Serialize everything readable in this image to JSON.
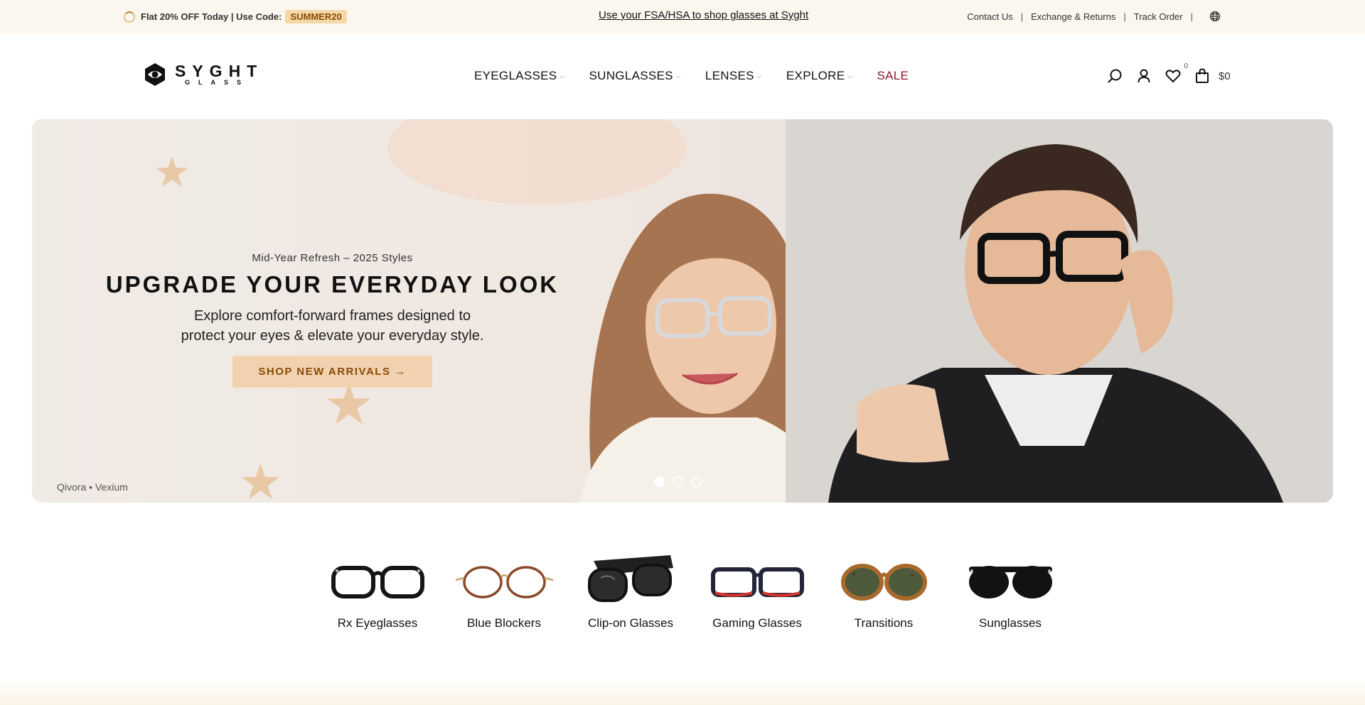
{
  "topbar": {
    "promo_text": "Flat 20% OFF Today | Use Code:",
    "promo_code": "SUMMER20",
    "fsa_link": "Use your FSA/HSA to shop glasses at Syght",
    "links": [
      "Contact Us",
      "Exchange & Returns",
      "Track Order"
    ],
    "separator": "|"
  },
  "brand": {
    "word": "SYGHT",
    "sub": "GLASS"
  },
  "nav": {
    "items": [
      {
        "label": "EYEGLASSES",
        "has_dropdown": true
      },
      {
        "label": "SUNGLASSES",
        "has_dropdown": true
      },
      {
        "label": "LENSES",
        "has_dropdown": true
      },
      {
        "label": "EXPLORE",
        "has_dropdown": true
      },
      {
        "label": "SALE",
        "has_dropdown": false
      }
    ],
    "chevron": "⌵"
  },
  "header_icons": {
    "icons": [
      "search-icon",
      "account-icon",
      "wishlist-icon",
      "cart-icon"
    ],
    "wishlist_count": "0",
    "cart_total": "$0"
  },
  "hero": {
    "eyebrow": "Mid-Year Refresh – 2025 Styles",
    "title": "UPGRADE YOUR EVERYDAY LOOK",
    "desc_line1": "Explore comfort-forward frames designed to",
    "desc_line2": "protect your eyes & elevate your everyday style.",
    "cta": "SHOP NEW ARRIVALS →",
    "credit": "Qivora • Vexium",
    "slides": 3,
    "active_slide": 1
  },
  "categories": [
    {
      "label": "Rx Eyeglasses",
      "icon": "round-black-frame"
    },
    {
      "label": "Blue Blockers",
      "icon": "thin-wire-frame"
    },
    {
      "label": "Clip-on Glasses",
      "icon": "clip-on-frame"
    },
    {
      "label": "Gaming Glasses",
      "icon": "red-black-frame"
    },
    {
      "label": "Transitions",
      "icon": "tortoise-tinted-frame"
    },
    {
      "label": "Sunglasses",
      "icon": "black-sunglasses"
    }
  ],
  "colors": {
    "topbar_bg": "#fbf6ee",
    "promo_code_bg": "#f5d8a8",
    "sale": "#8b1a2b",
    "cta_bg": "#f2d1b1",
    "cta_text": "#8a4b00"
  }
}
